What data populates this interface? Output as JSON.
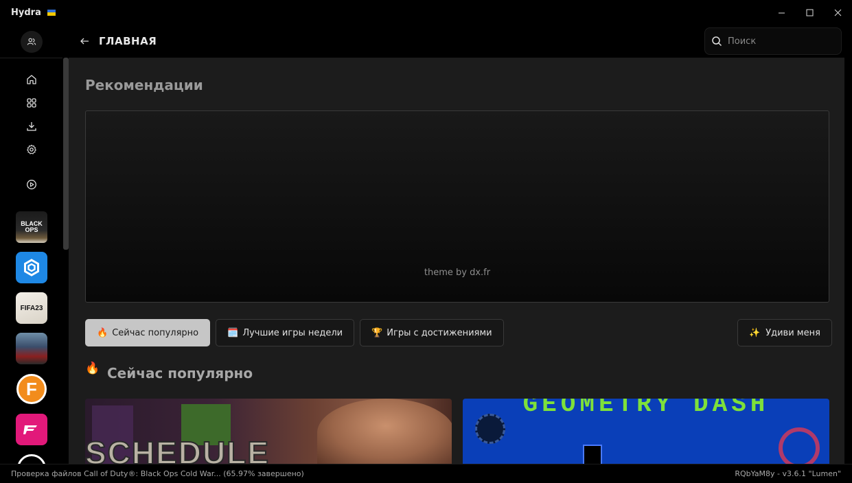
{
  "window": {
    "title": "Hydra"
  },
  "header": {
    "title": "ГЛАВНАЯ"
  },
  "search": {
    "placeholder": "Поиск"
  },
  "recommendations": {
    "title": "Рекомендации",
    "banner_credit": "theme by dx.fr"
  },
  "tabs": [
    {
      "emoji": "🔥",
      "label": "Сейчас популярно",
      "active": true
    },
    {
      "emoji": "🗓️",
      "label": "Лучшие игры недели",
      "active": false
    },
    {
      "emoji": "🏆",
      "label": "Игры с достижениями",
      "active": false
    }
  ],
  "surprise": {
    "emoji": "✨",
    "label": "Удиви меня"
  },
  "popular": {
    "emoji": "🔥",
    "title": "Сейчас популярно"
  },
  "cards": [
    {
      "text": "SCHEDULE"
    },
    {
      "text": "GEOMETRY DASH"
    }
  ],
  "sidebar": {
    "games": [
      {
        "name": "BLACK OPS"
      },
      {
        "name": ""
      },
      {
        "name": "FIFA23"
      },
      {
        "name": ""
      },
      {
        "name": "F"
      },
      {
        "name": ""
      }
    ]
  },
  "statusbar": {
    "left": "Проверка файлов Call of Duty®: Black Ops Cold War... (65.97% завершено)",
    "right": "RQbYaM8y - v3.6.1 \"Lumen\""
  },
  "colors": {
    "accent_tab": "#c6c6c6",
    "background": "#1c1c1c"
  }
}
